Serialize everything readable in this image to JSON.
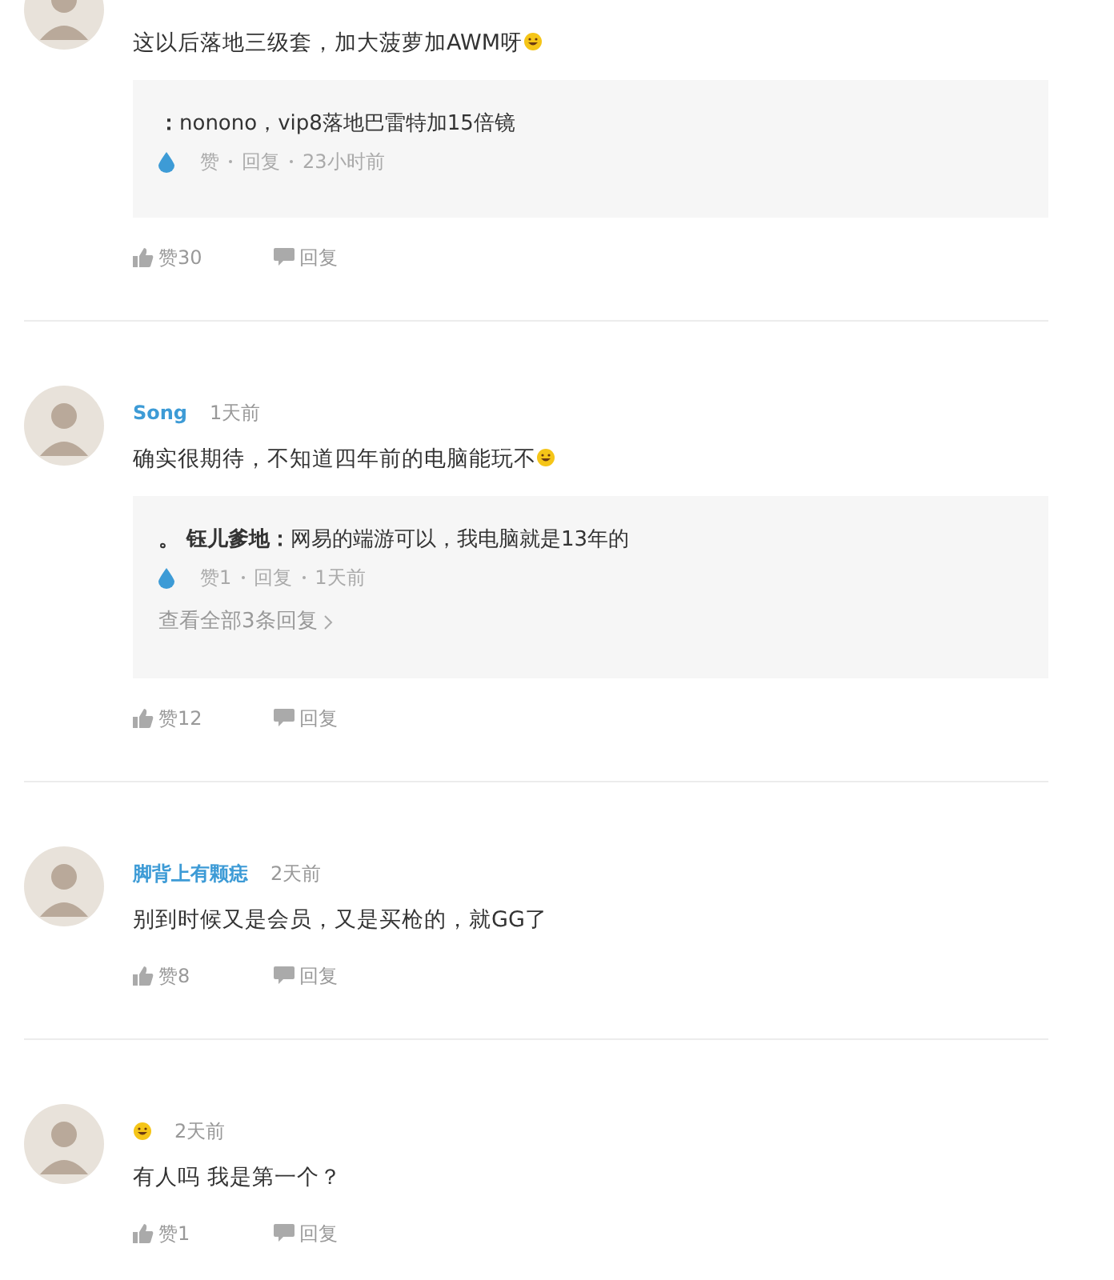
{
  "comments": [
    {
      "text": "这以后落地三级套，加大菠萝加AWM呀",
      "emoji": true,
      "replies": [
        {
          "author": "：",
          "text": "nonono，vip8落地巴雷特加15倍镜",
          "like": "赞",
          "reply": "回复",
          "time": "23小时前"
        }
      ],
      "likes": "赞30",
      "reply": "回复"
    },
    {
      "user": "Song",
      "time": "1天前",
      "text": "确实很期待，不知道四年前的电脑能玩不",
      "emoji": true,
      "replies": [
        {
          "author": "。 钰儿爹地：",
          "text": "网易的端游可以，我电脑就是13年的",
          "like": "赞1",
          "reply": "回复",
          "time": "1天前"
        }
      ],
      "view_all": "查看全部3条回复",
      "likes": "赞12",
      "reply": "回复"
    },
    {
      "user": "脚背上有颗痣",
      "time": "2天前",
      "text": "别到时候又是会员，又是买枪的，就GG了",
      "emoji": false,
      "likes": "赞8",
      "reply": "回复"
    },
    {
      "name_emoji": true,
      "time": "2天前",
      "text": "有人吗 我是第一个？",
      "emoji": false,
      "likes": "赞1",
      "reply": "回复"
    }
  ]
}
